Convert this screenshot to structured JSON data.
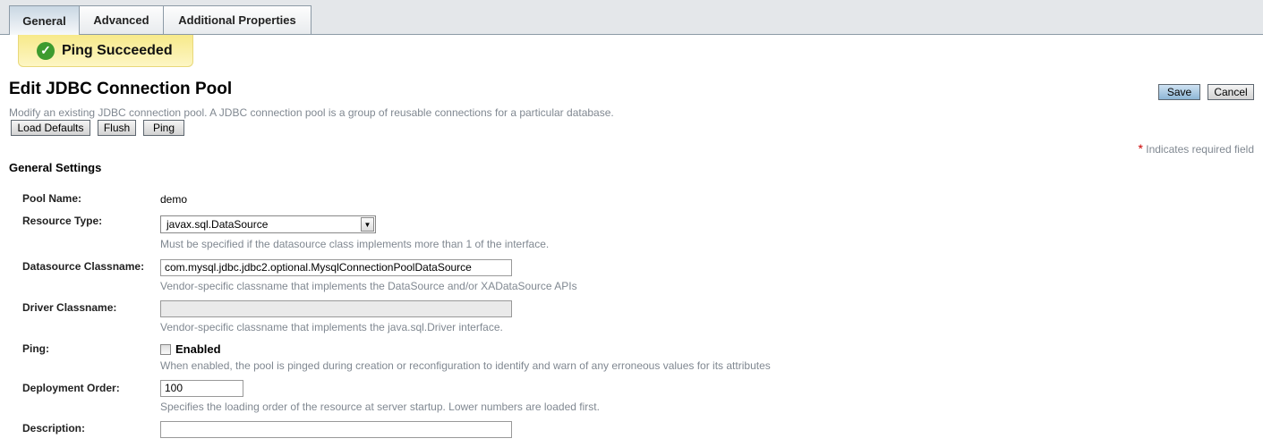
{
  "tabs": [
    {
      "label": "General",
      "active": true
    },
    {
      "label": "Advanced"
    },
    {
      "label": "Additional Properties"
    }
  ],
  "alert": {
    "text": "Ping Succeeded",
    "icon": "check-circle-icon",
    "color": "#3d9b2f"
  },
  "page": {
    "title": "Edit JDBC Connection Pool",
    "description": "Modify an existing JDBC connection pool. A JDBC connection pool is a group of reusable connections for a particular database."
  },
  "buttons": {
    "load_defaults": "Load Defaults",
    "flush": "Flush",
    "ping": "Ping",
    "save": "Save",
    "cancel": "Cancel"
  },
  "required_note": {
    "star": "*",
    "text": "Indicates required field"
  },
  "section_title": "General Settings",
  "fields": {
    "pool_name": {
      "label": "Pool Name:",
      "value": "demo"
    },
    "resource_type": {
      "label": "Resource Type:",
      "value": "javax.sql.DataSource",
      "help": "Must be specified if the datasource class implements more than 1 of the interface."
    },
    "datasource_classname": {
      "label": "Datasource Classname:",
      "value": "com.mysql.jdbc.jdbc2.optional.MysqlConnectionPoolDataSource",
      "help": "Vendor-specific classname that implements the DataSource and/or XADataSource APIs"
    },
    "driver_classname": {
      "label": "Driver Classname:",
      "value": "",
      "help": "Vendor-specific classname that implements the java.sql.Driver interface."
    },
    "ping": {
      "label": "Ping:",
      "checkbox_label": "Enabled",
      "checked": false,
      "help": "When enabled, the pool is pinged during creation or reconfiguration to identify and warn of any erroneous values for its attributes"
    },
    "deployment_order": {
      "label": "Deployment Order:",
      "value": "100",
      "help": "Specifies the loading order of the resource at server startup. Lower numbers are loaded first."
    },
    "description": {
      "label": "Description:",
      "value": ""
    }
  }
}
